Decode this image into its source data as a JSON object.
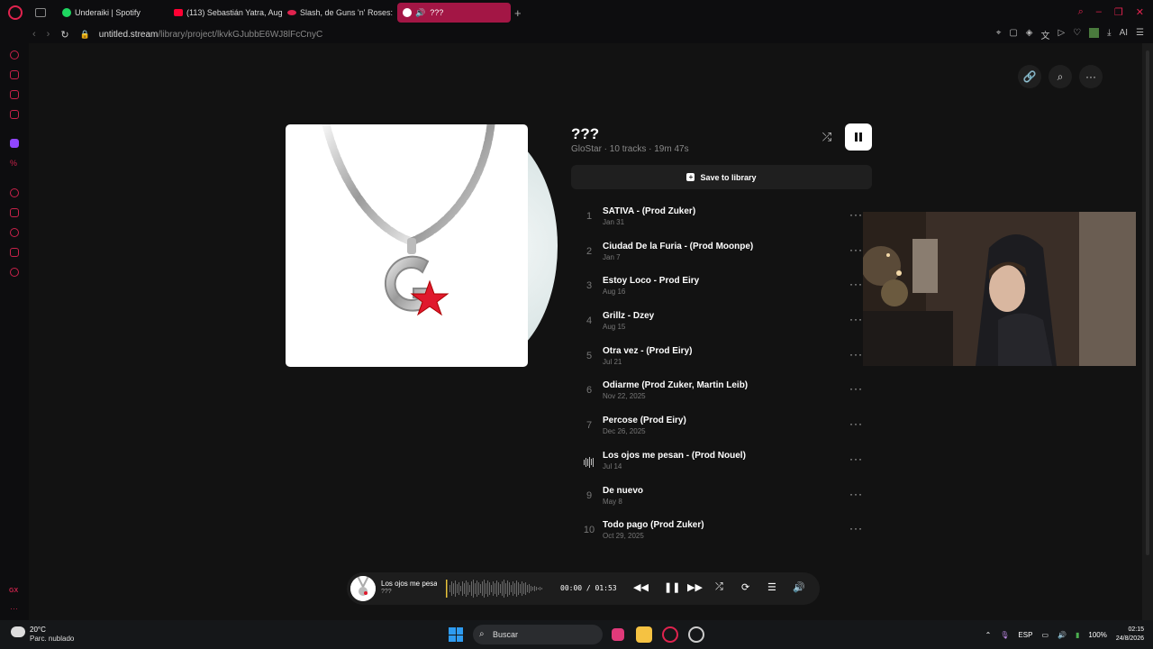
{
  "tabs": [
    {
      "label": "Underaiki | Spotify",
      "color": "#1ed760"
    },
    {
      "label": "(113) Sebastián Yatra, Aug",
      "color": "#ff0033"
    },
    {
      "label": "Slash, de Guns 'n' Roses:",
      "color": "#e0234e"
    },
    {
      "label": "???",
      "color": "#ffffff"
    }
  ],
  "address": {
    "host": "untitled.stream",
    "path": "/library/project/lkvkGJubbE6WJ8lFcCnyC"
  },
  "album": {
    "title": "???",
    "meta": "GloStar · 10 tracks · 19m 47s",
    "save_label": "Save to library"
  },
  "tracks": [
    {
      "num": "1",
      "name": "SATIVA - (Prod Zuker)",
      "date": "Jan 31"
    },
    {
      "num": "2",
      "name": "Ciudad De la Furia - (Prod Moonpe)",
      "date": "Jan 7"
    },
    {
      "num": "3",
      "name": "Estoy Loco - Prod Eiry",
      "date": "Aug 16"
    },
    {
      "num": "4",
      "name": "Grillz - Dzey",
      "date": "Aug 15"
    },
    {
      "num": "5",
      "name": "Otra vez - (Prod Eiry)",
      "date": "Jul 21"
    },
    {
      "num": "6",
      "name": "Odiarme (Prod Zuker, Martin Leib)",
      "date": "Nov 22, 2025"
    },
    {
      "num": "7",
      "name": "Percose (Prod Eiry)",
      "date": "Dec 26, 2025"
    },
    {
      "num": "",
      "name": "Los ojos me pesan - (Prod Nouel)",
      "date": "Jul 14",
      "playing": true
    },
    {
      "num": "9",
      "name": "De nuevo",
      "date": "May 8"
    },
    {
      "num": "10",
      "name": "Todo pago (Prod Zuker)",
      "date": "Oct 29, 2025"
    }
  ],
  "player": {
    "title": "Los ojos me pesan - (Prod Nouel)",
    "artist": "???",
    "time": "00:00 / 01:53"
  },
  "taskbar": {
    "temp": "20°C",
    "condition": "Parc. nublado",
    "search": "Buscar",
    "lang": "ESP",
    "battery": "100%",
    "time": "02:15",
    "date": "24/8/2026"
  },
  "sidebar_badge": "GX"
}
